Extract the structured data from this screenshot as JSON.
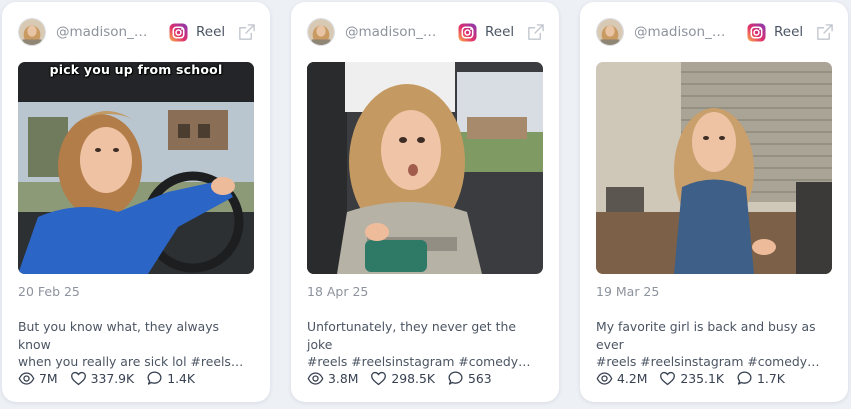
{
  "cards": [
    {
      "handle": "@madison_hu…",
      "type_label": "Reel",
      "thumb_caption": "pick you up from school",
      "date": "20 Feb 25",
      "caption": "But you know what, they always know\nwhen you really are sick lol #reels…",
      "views": "7M",
      "likes": "337.9K",
      "comments": "1.4K"
    },
    {
      "handle": "@madison_hu…",
      "type_label": "Reel",
      "thumb_caption": "",
      "date": "18 Apr 25",
      "caption": "Unfortunately, they never get the joke\n#reels #reelsinstagram #comedy…",
      "views": "3.8M",
      "likes": "298.5K",
      "comments": "563"
    },
    {
      "handle": "@madison_hu…",
      "type_label": "Reel",
      "thumb_caption": "",
      "date": "19 Mar 25",
      "caption": "My favorite girl is back and busy as ever\n#reels #reelsinstagram #comedy…",
      "views": "4.2M",
      "likes": "235.1K",
      "comments": "1.7K"
    }
  ],
  "icons": {
    "platform": "instagram-icon",
    "open": "external-link-icon",
    "views": "eye-icon",
    "likes": "heart-icon",
    "comments": "comment-icon"
  },
  "colors": {
    "page_bg": "#edf0f5",
    "card_bg": "#ffffff",
    "muted_text": "#8d939d",
    "body_text": "#4b5563"
  }
}
